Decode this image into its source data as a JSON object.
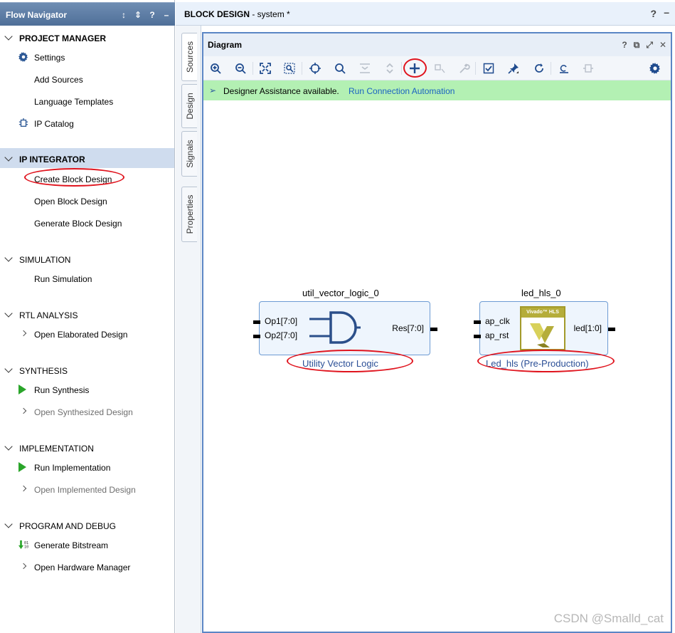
{
  "navigator": {
    "title": "Flow Navigator",
    "title_icons": [
      "↕",
      "⇕",
      "?",
      "–"
    ],
    "sections": [
      {
        "label": "PROJECT MANAGER",
        "items": [
          "Settings",
          "Add Sources",
          "Language Templates",
          "IP Catalog"
        ]
      },
      {
        "label": "IP INTEGRATOR",
        "items": [
          "Create Block Design",
          "Open Block Design",
          "Generate Block Design"
        ]
      },
      {
        "label": "SIMULATION",
        "items": [
          "Run Simulation"
        ]
      },
      {
        "label": "RTL ANALYSIS",
        "items": [
          "Open Elaborated Design"
        ]
      },
      {
        "label": "SYNTHESIS",
        "items": [
          "Run Synthesis",
          "Open Synthesized Design"
        ]
      },
      {
        "label": "IMPLEMENTATION",
        "items": [
          "Run Implementation",
          "Open Implemented Design"
        ]
      },
      {
        "label": "PROGRAM AND DEBUG",
        "items": [
          "Generate Bitstream",
          "Open Hardware Manager"
        ]
      }
    ]
  },
  "main": {
    "title_bold": "BLOCK DESIGN",
    "title_rest": " - system *",
    "help": "?",
    "vertical_tabs": [
      "Sources",
      "Design",
      "Signals",
      "Properties"
    ]
  },
  "diagram": {
    "title": "Diagram",
    "title_icons": [
      "?",
      "⧉",
      "⤢",
      "✕"
    ],
    "assist_text": "Designer Assistance available.",
    "assist_link": "Run Connection Automation",
    "blocks": [
      {
        "instance": "util_vector_logic_0",
        "inputs": [
          "Op1[7:0]",
          "Op2[7:0]"
        ],
        "output": "Res[7:0]",
        "subtitle": "Utility Vector Logic"
      },
      {
        "instance": "led_hls_0",
        "inputs": [
          "ap_clk",
          "ap_rst"
        ],
        "output": "led[1:0]",
        "logo_text": "Vivado™ HLS",
        "subtitle": "Led_hls (Pre-Production)"
      }
    ]
  },
  "watermark": "CSDN @Smalld_cat",
  "colors": {
    "nav_header": "#5b7ba6",
    "selected_section": "#cfdcee",
    "assist_bar": "#b3f0b3",
    "block_fill": "#eef5fd",
    "block_border": "#6d9bd3",
    "annotation_red": "#e0141e"
  }
}
